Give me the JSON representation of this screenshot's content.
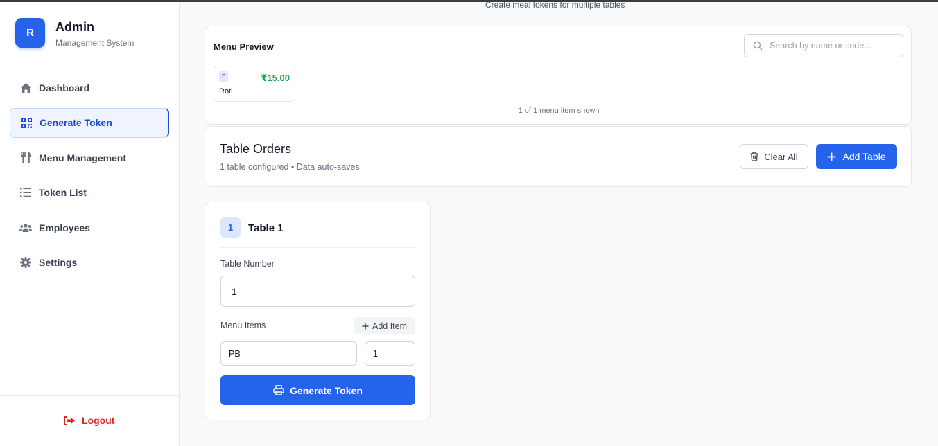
{
  "header": {
    "subtitle": "Create meal tokens for multiple tables"
  },
  "brand": {
    "logo_letter": "R",
    "title": "Admin",
    "subtitle": "Management System"
  },
  "sidebar": {
    "items": [
      {
        "label": "Dashboard",
        "icon": "home-icon",
        "active": false
      },
      {
        "label": "Generate Token",
        "icon": "qrcode-icon",
        "active": true
      },
      {
        "label": "Menu Management",
        "icon": "utensils-icon",
        "active": false
      },
      {
        "label": "Token List",
        "icon": "list-icon",
        "active": false
      },
      {
        "label": "Employees",
        "icon": "users-icon",
        "active": false
      },
      {
        "label": "Settings",
        "icon": "gear-icon",
        "active": false
      }
    ],
    "logout_label": "Logout"
  },
  "menu_preview": {
    "title": "Menu Preview",
    "search_placeholder": "Search by name or code...",
    "items": [
      {
        "code": "r",
        "price": "₹15.00",
        "name": "Roti"
      }
    ],
    "shown_text": "1 of 1 menu item shown"
  },
  "table_orders": {
    "title": "Table Orders",
    "subtitle": "1 table configured • Data auto-saves",
    "clear_all_label": "Clear All",
    "add_table_label": "Add Table"
  },
  "table": {
    "badge": "1",
    "title": "Table 1",
    "table_number_label": "Table Number",
    "table_number_value": "1",
    "menu_items_label": "Menu Items",
    "add_item_label": "Add Item",
    "item_code_value": "PB",
    "item_qty_value": "1",
    "generate_label": "Generate Token"
  },
  "colors": {
    "accent": "#2563eb",
    "price": "#16a34a",
    "logout": "#dc2626"
  }
}
